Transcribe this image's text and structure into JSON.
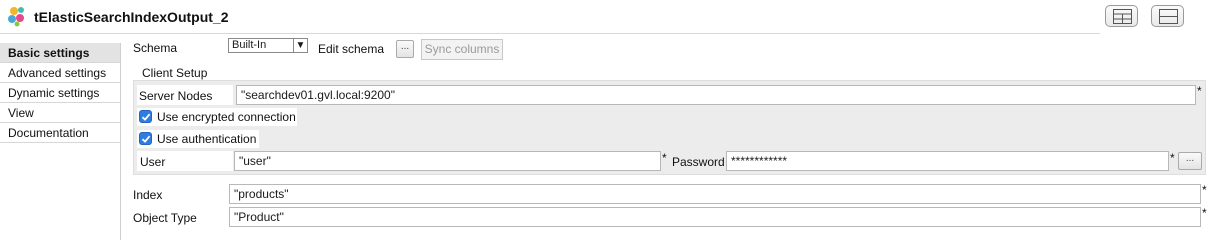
{
  "header": {
    "title": "tElasticSearchIndexOutput_2"
  },
  "sidebar": {
    "items": [
      {
        "label": "Basic settings",
        "active": true
      },
      {
        "label": "Advanced settings"
      },
      {
        "label": "Dynamic settings"
      },
      {
        "label": "View"
      },
      {
        "label": "Documentation"
      }
    ]
  },
  "schema": {
    "label": "Schema",
    "value": "Built-In",
    "edit_label": "Edit schema",
    "edit_button": "...",
    "sync_button": "Sync columns"
  },
  "client_setup": {
    "title": "Client Setup",
    "server_nodes_label": "Server Nodes",
    "server_nodes_value": "\"searchdev01.gvl.local:9200\"",
    "use_encrypted_label": "Use encrypted connection",
    "use_encrypted_checked": true,
    "use_auth_label": "Use authentication",
    "use_auth_checked": true,
    "user_label": "User",
    "user_value": "\"user\"",
    "password_label": "Password",
    "password_value": "************",
    "password_button": "..."
  },
  "index": {
    "label": "Index",
    "value": "\"products\""
  },
  "object_type": {
    "label": "Object Type",
    "value": "\"Product\""
  },
  "required_mark": "*",
  "colors": {
    "checkbox": "#2f7de1",
    "group_bg": "#ececec",
    "active_tab": "#e3e3e3"
  }
}
